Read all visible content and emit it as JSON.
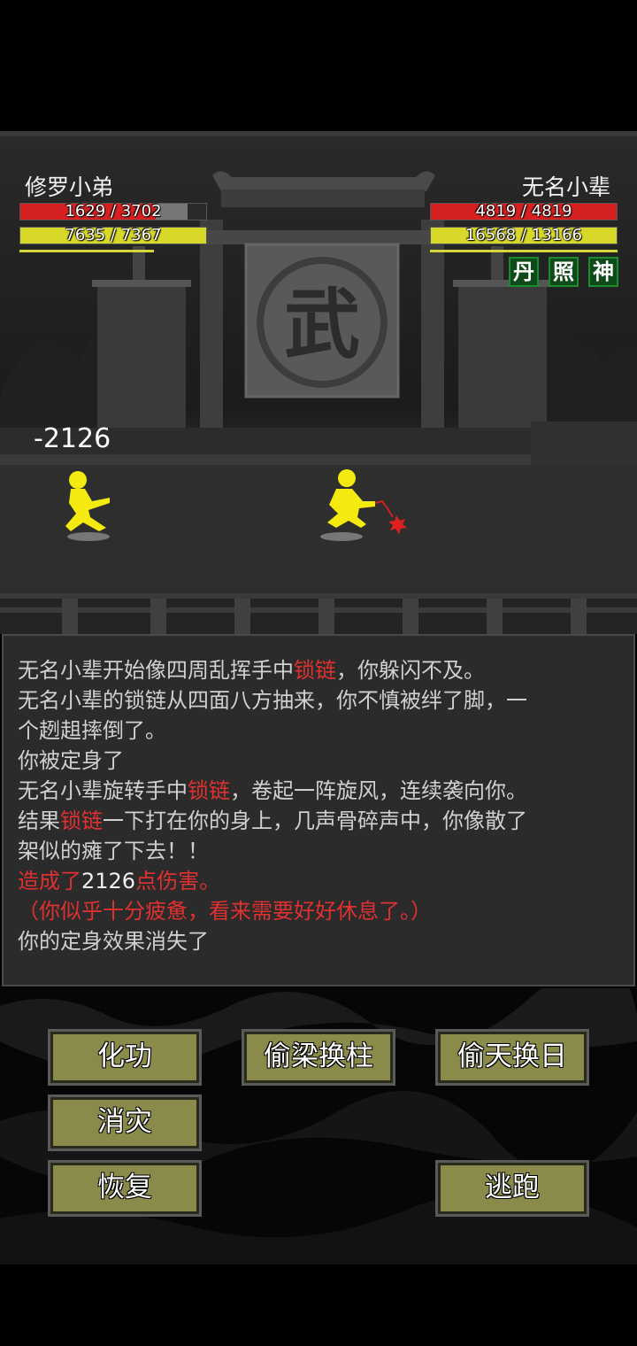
{
  "player": {
    "name": "修罗小弟",
    "hp": "1629 / 3702",
    "hp_ratio": 0.44,
    "mp": "7635 / 7367",
    "mp_ratio": 1.0
  },
  "enemy": {
    "name": "无名小辈",
    "hp": "4819 / 4819",
    "hp_ratio": 1.0,
    "mp": "16568 / 13166",
    "mp_ratio": 1.0
  },
  "buffs": [
    "丹",
    "照",
    "神"
  ],
  "scene": {
    "sign_char": "武"
  },
  "damage_popup": "-2126",
  "log": {
    "l1a": "无名小辈开始像四周乱挥手中",
    "l1b": "锁链",
    "l1c": "，你躲闪不及。",
    "l2": "无名小辈的锁链从四面八方抽来，你不慎被绊了脚，一",
    "l3": "个趔趄摔倒了。",
    "l4": "你被定身了",
    "l5a": "无名小辈旋转手中",
    "l5b": "锁链",
    "l5c": "，卷起一阵旋风，连续袭向你。",
    "l6a": "结果",
    "l6b": "锁链",
    "l6c": "一下打在你的身上，几声骨碎声中，你像散了",
    "l7": "架似的瘫了下去！！",
    "l8a": "造成了",
    "l8b": "2126",
    "l8c": "点伤害。",
    "l9": "（你似乎十分疲惫，看来需要好好休息了。）",
    "l10": "你的定身效果消失了"
  },
  "buttons": {
    "huagong": "化功",
    "touliang": "偷梁换柱",
    "toutian": "偷天换日",
    "xiaozai": "消灾",
    "huifu": "恢复",
    "taopao": "逃跑"
  },
  "colors": {
    "hp": "#d42020",
    "mp": "#d8d82a",
    "button": "#8a8a4a",
    "buff": "#0f4a1a"
  }
}
